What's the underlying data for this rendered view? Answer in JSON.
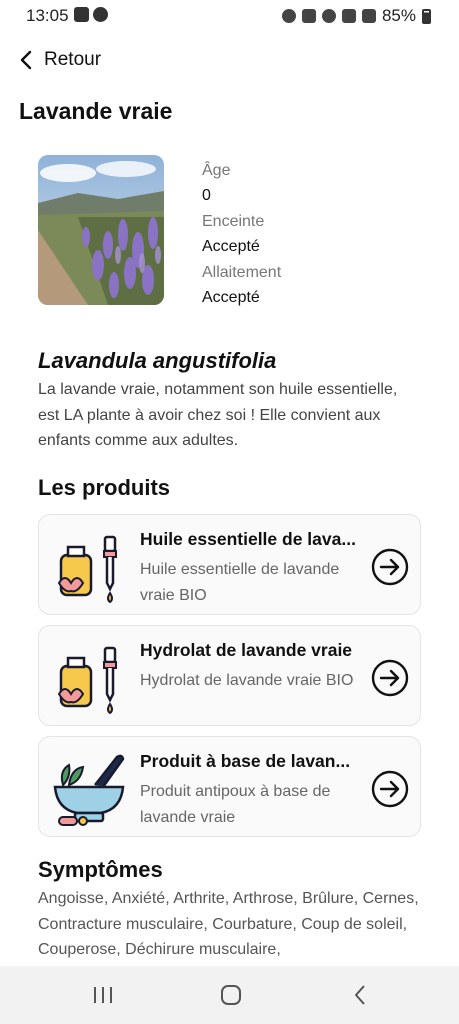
{
  "status_bar": {
    "time": "13:05",
    "battery": "85%",
    "icons": [
      "gallery-icon",
      "messenger-icon",
      "alarm-icon",
      "mute-icon",
      "wifi-icon",
      "volte-icon",
      "signal-icon",
      "battery-icon"
    ]
  },
  "header": {
    "back_label": "Retour",
    "title": "Lavande vraie"
  },
  "info": {
    "age_label": "Âge",
    "age_value": "0",
    "pregnant_label": "Enceinte",
    "pregnant_value": "Accepté",
    "breastfeeding_label": "Allaitement",
    "breastfeeding_value": "Accepté"
  },
  "plant": {
    "latin_name": "Lavandula angustifolia",
    "description": "La lavande vraie, notamment son huile essentielle, est LA plante à avoir chez soi ! Elle convient aux enfants comme aux adultes."
  },
  "products": {
    "section_title": "Les produits",
    "items": [
      {
        "name": "Huile essentielle de lava...",
        "subtitle": "Huile essentielle de lavande vraie BIO",
        "icon": "essential-oil-icon"
      },
      {
        "name": "Hydrolat de lavande vraie",
        "subtitle": "Hydrolat de lavande vraie BIO",
        "icon": "essential-oil-icon"
      },
      {
        "name": "Produit à base de lavan...",
        "subtitle": "Produit antipoux à base de lavande vraie",
        "icon": "mortar-pestle-icon"
      }
    ]
  },
  "symptoms": {
    "section_title": "Symptômes",
    "text": "Angoisse, Anxiété, Arthrite, Arthrose, Brûlure, Cernes, Contracture musculaire, Courbature, Coup de soleil, Couperose, Déchirure musculaire,"
  },
  "colors": {
    "accent_purple": "#8a73c4",
    "bottle_fill": "#f6c94c",
    "flower_pink": "#f29a9a",
    "icon_outline": "#1a1a2e",
    "card_border": "#e4e4e4"
  }
}
